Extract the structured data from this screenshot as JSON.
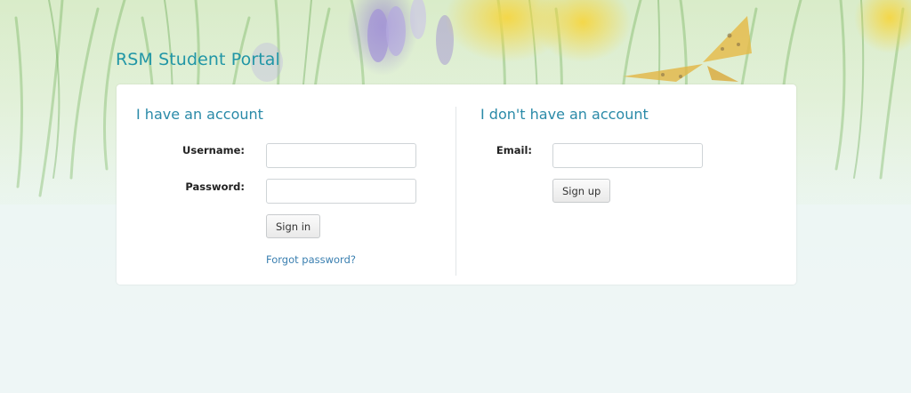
{
  "header": {
    "title": "RSM Student Portal"
  },
  "login": {
    "heading": "I have an account",
    "username_label": "Username:",
    "username_value": "",
    "password_label": "Password:",
    "password_value": "",
    "signin_label": "Sign in",
    "forgot_label": "Forgot password?"
  },
  "signup": {
    "heading": "I don't have an account",
    "email_label": "Email:",
    "email_value": "",
    "signup_label": "Sign up"
  },
  "colors": {
    "accent": "#2196a6",
    "heading": "#2a8aa8",
    "link": "#3a7fb0",
    "background": "#edf6f5"
  }
}
